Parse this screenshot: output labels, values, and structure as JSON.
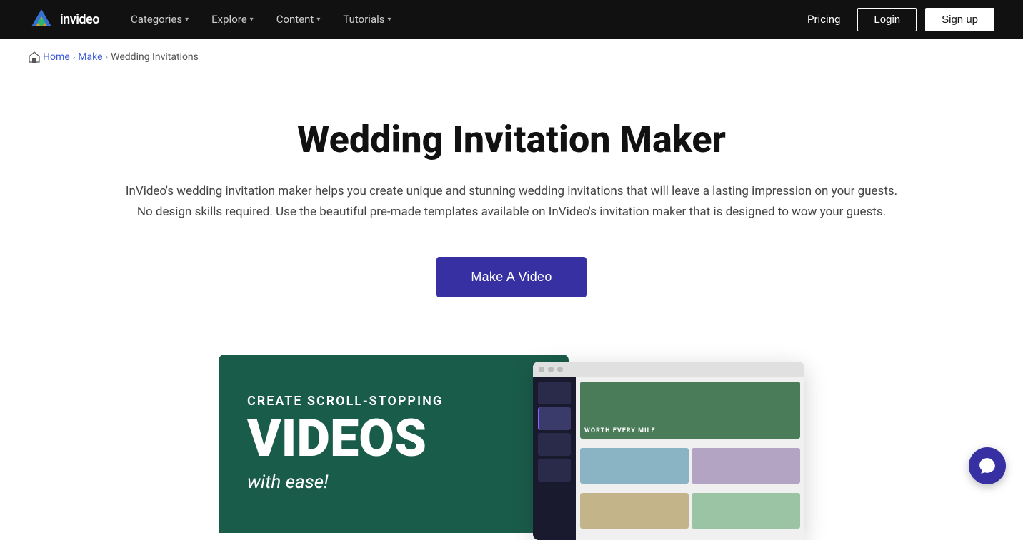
{
  "nav": {
    "logo_text": "invideo",
    "links": [
      {
        "label": "Categories",
        "has_dropdown": true
      },
      {
        "label": "Explore",
        "has_dropdown": true
      },
      {
        "label": "Content",
        "has_dropdown": true
      },
      {
        "label": "Tutorials",
        "has_dropdown": true
      }
    ],
    "pricing_label": "Pricing",
    "login_label": "Login",
    "signup_label": "Sign up"
  },
  "breadcrumb": {
    "home_label": "Home",
    "make_label": "Make",
    "current": "Wedding Invitations"
  },
  "hero": {
    "title": "Wedding Invitation Maker",
    "description_line1": "InVideo's wedding invitation maker helps you create unique and stunning wedding invitations that will leave a lasting impression on your guests.",
    "description_line2": "No design skills required. Use the beautiful pre-made templates available on InVideo's invitation maker that is designed to wow your guests.",
    "cta_label": "Make A Video"
  },
  "preview": {
    "card_subtitle": "CREATE SCROLL-STOPPING",
    "card_main": "VIDEOS",
    "card_ease": "with ease!",
    "browser_featured_label": "WORTH EVERY MILE"
  },
  "chat": {
    "label": "chat-button"
  }
}
